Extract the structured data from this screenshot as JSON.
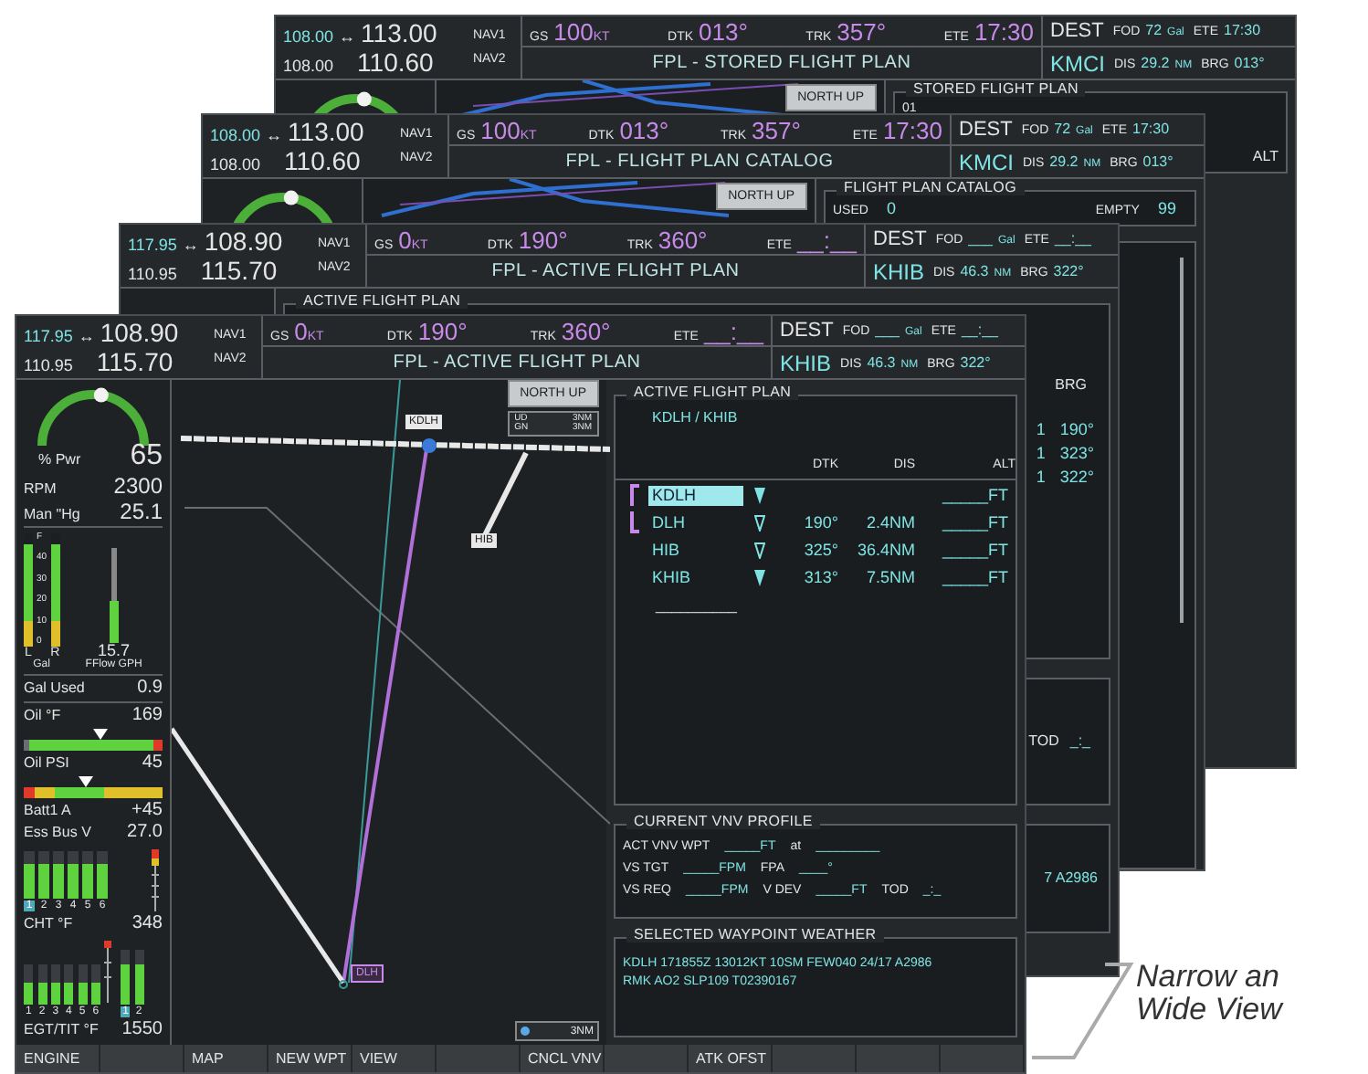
{
  "screens": [
    {
      "kind": "stored",
      "header": {
        "standby_1": "108.00",
        "swap": "↔",
        "active_1": "113.00",
        "standby_2": "108.00",
        "active_2": "110.60",
        "nav_1": "NAV1",
        "nav_2": "NAV2",
        "gs_label": "GS",
        "gs": "100",
        "gs_unit": "KT",
        "dtk_label": "DTK",
        "dtk": "013°",
        "trk_label": "TRK",
        "trk": "357°",
        "ete_label": "ETE",
        "ete": "17:30",
        "title": "FPL - STORED FLIGHT PLAN",
        "dest_label": "DEST",
        "fod_label": "FOD",
        "fod": "72",
        "fod_unit": "Gal",
        "ete2_label": "ETE",
        "ete2": "17:30",
        "dest": "KMCI",
        "dis_label": "DIS",
        "dis": "29.2",
        "dis_unit": "NM",
        "brg_label": "BRG",
        "brg": "013°"
      },
      "map": {
        "orientation": "NORTH UP"
      },
      "panel": {
        "title": "STORED FLIGHT PLAN",
        "first_row": "01",
        "column": "ALT"
      }
    },
    {
      "kind": "catalog",
      "header": {
        "standby_1": "108.00",
        "swap": "↔",
        "active_1": "113.00",
        "standby_2": "108.00",
        "active_2": "110.60",
        "nav_1": "NAV1",
        "nav_2": "NAV2",
        "gs_label": "GS",
        "gs": "100",
        "gs_unit": "KT",
        "dtk_label": "DTK",
        "dtk": "013°",
        "trk_label": "TRK",
        "trk": "357°",
        "ete_label": "ETE",
        "ete": "17:30",
        "title": "FPL - FLIGHT PLAN CATALOG",
        "dest_label": "DEST",
        "fod_label": "FOD",
        "fod": "72",
        "fod_unit": "Gal",
        "ete2_label": "ETE",
        "ete2": "17:30",
        "dest": "KMCI",
        "dis_label": "DIS",
        "dis": "29.2",
        "dis_unit": "NM",
        "brg_label": "BRG",
        "brg": "013°"
      },
      "map": {
        "orientation": "NORTH UP"
      },
      "panel": {
        "title": "FLIGHT PLAN CATALOG",
        "used_label": "USED",
        "used": "0",
        "empty_label": "EMPTY",
        "empty": "99"
      }
    },
    {
      "kind": "wide",
      "header": {
        "standby_1": "117.95",
        "swap": "↔",
        "active_1": "108.90",
        "standby_2": "110.95",
        "active_2": "115.70",
        "nav_1": "NAV1",
        "nav_2": "NAV2",
        "gs_label": "GS",
        "gs": "0",
        "gs_unit": "KT",
        "dtk_label": "DTK",
        "dtk": "190°",
        "trk_label": "TRK",
        "trk": "360°",
        "ete_label": "ETE",
        "ete": "__:__",
        "title": "FPL - ACTIVE FLIGHT PLAN",
        "dest_label": "DEST",
        "fod_label": "FOD",
        "fod": "___",
        "fod_unit": "Gal",
        "ete2_label": "ETE",
        "ete2": "__:__",
        "dest": "KHIB",
        "dis_label": "DIS",
        "dis": "46.3",
        "dis_unit": "NM",
        "brg_label": "BRG",
        "brg": "322°"
      },
      "panel": {
        "title": "ACTIVE FLIGHT PLAN",
        "column": "BRG",
        "rows": [
          {
            "column_a": "1",
            "column_b": "190°"
          },
          {
            "column_a": "1",
            "column_b": "323°"
          },
          {
            "column_a": "1",
            "column_b": "322°"
          }
        ],
        "tod_label": "TOD",
        "tod": "_:_",
        "weather": "7 A2986"
      }
    },
    {
      "kind": "narrow",
      "header": {
        "standby_1": "117.95",
        "swap": "↔",
        "active_1": "108.90",
        "standby_2": "110.95",
        "active_2": "115.70",
        "nav_1": "NAV1",
        "nav_2": "NAV2",
        "gs_label": "GS",
        "gs": "0",
        "gs_unit": "KT",
        "dtk_label": "DTK",
        "dtk": "190°",
        "trk_label": "TRK",
        "trk": "360°",
        "ete_label": "ETE",
        "ete": "__:__",
        "title": "FPL - ACTIVE FLIGHT PLAN",
        "dest_label": "DEST",
        "fod_label": "FOD",
        "fod": "___",
        "fod_unit": "Gal",
        "ete2_label": "ETE",
        "ete2": "__:__",
        "dest": "KHIB",
        "dis_label": "DIS",
        "dis": "46.3",
        "dis_unit": "NM",
        "brg_label": "BRG",
        "brg": "322°"
      },
      "engine": {
        "power": {
          "label": "% Pwr",
          "value": "65",
          "level": 0.55
        },
        "readouts": [
          {
            "label": "RPM",
            "value": "2300"
          },
          {
            "label": "Man \"Hg",
            "value": "25.1"
          }
        ],
        "fuel": {
          "scale": [
            "F",
            "40",
            "30",
            "20",
            "10",
            "0"
          ],
          "tanks": [
            {
              "label": "L",
              "level": 0.9
            },
            {
              "label": "R",
              "level": 0.9
            }
          ],
          "unit": "Gal",
          "flow": {
            "value": "15.7",
            "label": "FFlow GPH",
            "level": 0.45
          }
        },
        "gal_used": {
          "label": "Gal Used",
          "value": "0.9"
        },
        "oil_temp": {
          "label": "Oil °F",
          "value": "169",
          "level": 0.55
        },
        "oil_psi": {
          "label": "Oil PSI",
          "value": "45",
          "level": 0.45
        },
        "electrical": [
          {
            "label": "Batt1 A",
            "value": "+45"
          },
          {
            "label": "Ess Bus V",
            "value": "27.0"
          }
        ],
        "cht": {
          "label": "CHT °F",
          "value": "348",
          "cylinders": [
            {
              "number": "1",
              "level": 0.75,
              "selected": true
            },
            {
              "number": "2",
              "level": 0.75,
              "selected": false
            },
            {
              "number": "3",
              "level": 0.75,
              "selected": false
            },
            {
              "number": "4",
              "level": 0.75,
              "selected": false
            },
            {
              "number": "5",
              "level": 0.75,
              "selected": false
            },
            {
              "number": "6",
              "level": 0.75,
              "selected": false
            }
          ]
        },
        "egt": {
          "label": "EGT/TIT °F",
          "value": "1550",
          "cylinders": [
            {
              "number": "1",
              "level": 0.55
            },
            {
              "number": "2",
              "level": 0.55
            },
            {
              "number": "3",
              "level": 0.55
            },
            {
              "number": "4",
              "level": 0.55
            },
            {
              "number": "5",
              "level": 0.55
            },
            {
              "number": "6",
              "level": 0.55
            }
          ],
          "tit": [
            {
              "number": "1",
              "level": 0.75,
              "selected": true
            },
            {
              "number": "2",
              "level": 0.75,
              "selected": false
            }
          ]
        }
      },
      "map": {
        "orientation": "NORTH UP",
        "legend": [
          {
            "label": "UD",
            "value": "3NM"
          },
          {
            "label": "GN",
            "value": "3NM"
          }
        ],
        "waypoints": [
          {
            "label": "KDLH"
          },
          {
            "label": "HIB"
          },
          {
            "label": "DLH"
          }
        ],
        "range": "3NM"
      },
      "flight_plan": {
        "title": "ACTIVE FLIGHT PLAN",
        "route": "KDLH / KHIB",
        "columns": [
          "DTK",
          "DIS",
          "ALT"
        ],
        "rows": [
          {
            "waypoint": "KDLH",
            "selected": true,
            "active": true,
            "kind": "filled",
            "alt": "_____FT"
          },
          {
            "waypoint": "DLH",
            "selected": false,
            "active": true,
            "kind": "outline",
            "dtk": "190°",
            "dis": "2.4NM",
            "alt": "_____FT"
          },
          {
            "waypoint": "HIB",
            "selected": false,
            "active": false,
            "kind": "outline",
            "dtk": "325°",
            "dis": "36.4NM",
            "alt": "_____FT"
          },
          {
            "waypoint": "KHIB",
            "selected": false,
            "active": false,
            "kind": "filled",
            "dtk": "313°",
            "dis": "7.5NM",
            "alt": "_____FT"
          }
        ],
        "end": "__________"
      },
      "vnv": {
        "title": "CURRENT VNV PROFILE",
        "lines": [
          [
            {
              "kind": "label",
              "text": "ACT VNV WPT"
            },
            {
              "kind": "value",
              "text": "_____FT"
            },
            {
              "kind": "label",
              "text": "at"
            },
            {
              "kind": "value",
              "text": "_________"
            }
          ],
          [
            {
              "kind": "label",
              "text": "VS TGT"
            },
            {
              "kind": "value",
              "text": "_____FPM"
            },
            {
              "kind": "label",
              "text": "FPA"
            },
            {
              "kind": "value",
              "text": "____°"
            }
          ],
          [
            {
              "kind": "label",
              "text": "VS REQ"
            },
            {
              "kind": "value",
              "text": "_____FPM"
            },
            {
              "kind": "label",
              "text": "V DEV"
            },
            {
              "kind": "value",
              "text": "_____FT"
            },
            {
              "kind": "label",
              "text": "TOD"
            },
            {
              "kind": "value",
              "text": "_:_"
            }
          ]
        ]
      },
      "weather": {
        "title": "SELECTED WAYPOINT WEATHER",
        "lines": [
          "KDLH 171855Z 13012KT 10SM FEW040 24/17 A2986",
          "RMK AO2 SLP109 T02390167"
        ]
      },
      "softkeys": [
        "ENGINE",
        "MAP",
        "NEW WPT",
        "VIEW",
        "CNCL VNV",
        "ATK OFST"
      ]
    }
  ],
  "caption": [
    "Narrow an",
    "Wide View"
  ]
}
